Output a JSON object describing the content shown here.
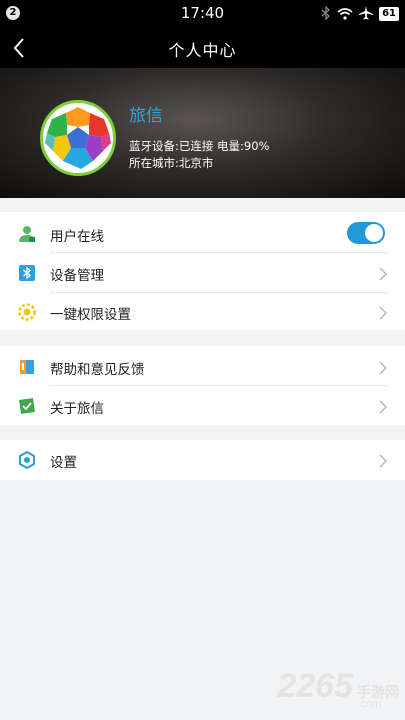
{
  "status_bar": {
    "notification_count": "2",
    "time": "17:40",
    "battery": "61"
  },
  "nav": {
    "title": "个人中心"
  },
  "profile": {
    "name": "旅信",
    "device_status": "蓝牙设备:已连接 电量:90%",
    "city": "所在城市:北京市"
  },
  "menu_group_1": [
    {
      "label": "用户在线",
      "icon": "user-online-icon",
      "toggle_on": true
    },
    {
      "label": "设备管理",
      "icon": "bluetooth-icon"
    },
    {
      "label": "一键权限设置",
      "icon": "gear-flower-icon"
    }
  ],
  "menu_group_2": [
    {
      "label": "帮助和意见反馈",
      "icon": "help-book-icon"
    },
    {
      "label": "关于旅信",
      "icon": "about-icon"
    }
  ],
  "menu_group_3": [
    {
      "label": "设置",
      "icon": "settings-icon"
    }
  ],
  "watermark": {
    "number": "2265",
    "site": "手游网",
    "domain": ".com"
  },
  "colors": {
    "accent": "#1e9ad6",
    "name_color": "#29a6e0",
    "avatar_ring": "#7fcf3a"
  }
}
